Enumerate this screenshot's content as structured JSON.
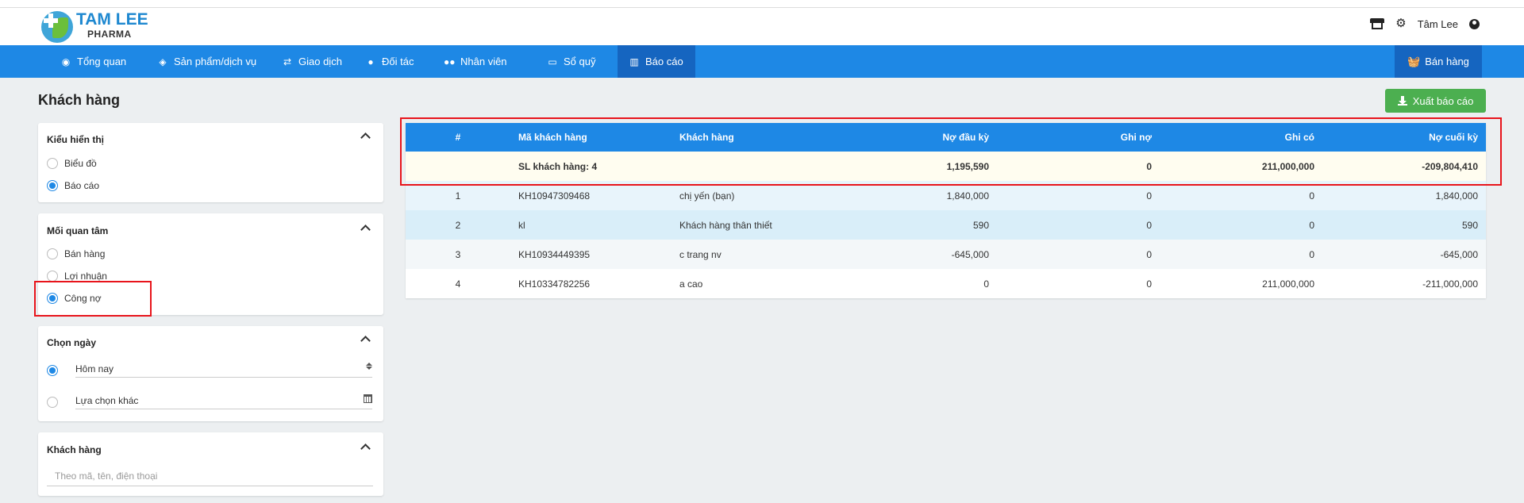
{
  "brand": {
    "name": "TAM LEE",
    "sub": "PHARMA"
  },
  "header": {
    "user_name": "Tâm Lee",
    "store_icon": "store-icon",
    "settings_icon": "gear-icon",
    "user_icon": "user-circle-icon"
  },
  "nav": {
    "items": [
      {
        "label": "Tổng quan",
        "icon": "eye-icon"
      },
      {
        "label": "Sản phẩm/dịch vụ",
        "icon": "cube-icon"
      },
      {
        "label": "Giao dịch",
        "icon": "exchange-icon"
      },
      {
        "label": "Đối tác",
        "icon": "user-icon"
      },
      {
        "label": "Nhân viên",
        "icon": "users-icon"
      },
      {
        "label": "Sổ quỹ",
        "icon": "money-icon"
      },
      {
        "label": "Báo cáo",
        "icon": "chart-icon",
        "active": true
      }
    ],
    "sell_label": "Bán hàng"
  },
  "page": {
    "title": "Khách hàng",
    "export_label": "Xuất báo cáo"
  },
  "filters": {
    "display": {
      "title": "Kiểu hiển thị",
      "options": [
        "Biểu đồ",
        "Báo cáo"
      ],
      "selected": "Báo cáo"
    },
    "concern": {
      "title": "Mối quan tâm",
      "options": [
        "Bán hàng",
        "Lợi nhuận",
        "Công nợ"
      ],
      "selected": "Công nợ"
    },
    "date": {
      "title": "Chọn ngày",
      "today": "Hôm nay",
      "other": "Lựa chọn khác",
      "selected": "Hôm nay"
    },
    "customer": {
      "title": "Khách hàng",
      "placeholder": "Theo mã, tên, điện thoại"
    }
  },
  "table": {
    "headers": [
      "#",
      "Mã khách hàng",
      "Khách hàng",
      "Nợ đầu kỳ",
      "Ghi nợ",
      "Ghi có",
      "Nợ cuối kỳ"
    ],
    "summary": {
      "label": "SL khách hàng: 4",
      "opening": "1,195,590",
      "debit": "0",
      "credit": "211,000,000",
      "closing": "-209,804,410"
    },
    "rows": [
      {
        "no": "1",
        "code": "KH10947309468",
        "name": "chị yến (bạn)",
        "opening": "1,840,000",
        "debit": "0",
        "credit": "0",
        "closing": "1,840,000"
      },
      {
        "no": "2",
        "code": "kl",
        "name": "Khách hàng thân thiết",
        "opening": "590",
        "debit": "0",
        "credit": "0",
        "closing": "590"
      },
      {
        "no": "3",
        "code": "KH10934449395",
        "name": "c trang nv",
        "opening": "-645,000",
        "debit": "0",
        "credit": "0",
        "closing": "-645,000"
      },
      {
        "no": "4",
        "code": "KH10334782256",
        "name": "a cao",
        "opening": "0",
        "debit": "0",
        "credit": "211,000,000",
        "closing": "-211,000,000"
      }
    ]
  },
  "colors": {
    "primary": "#1e88e5",
    "nav_active": "#1565c0",
    "export": "#4caf50",
    "highlight": "#e8141b"
  }
}
